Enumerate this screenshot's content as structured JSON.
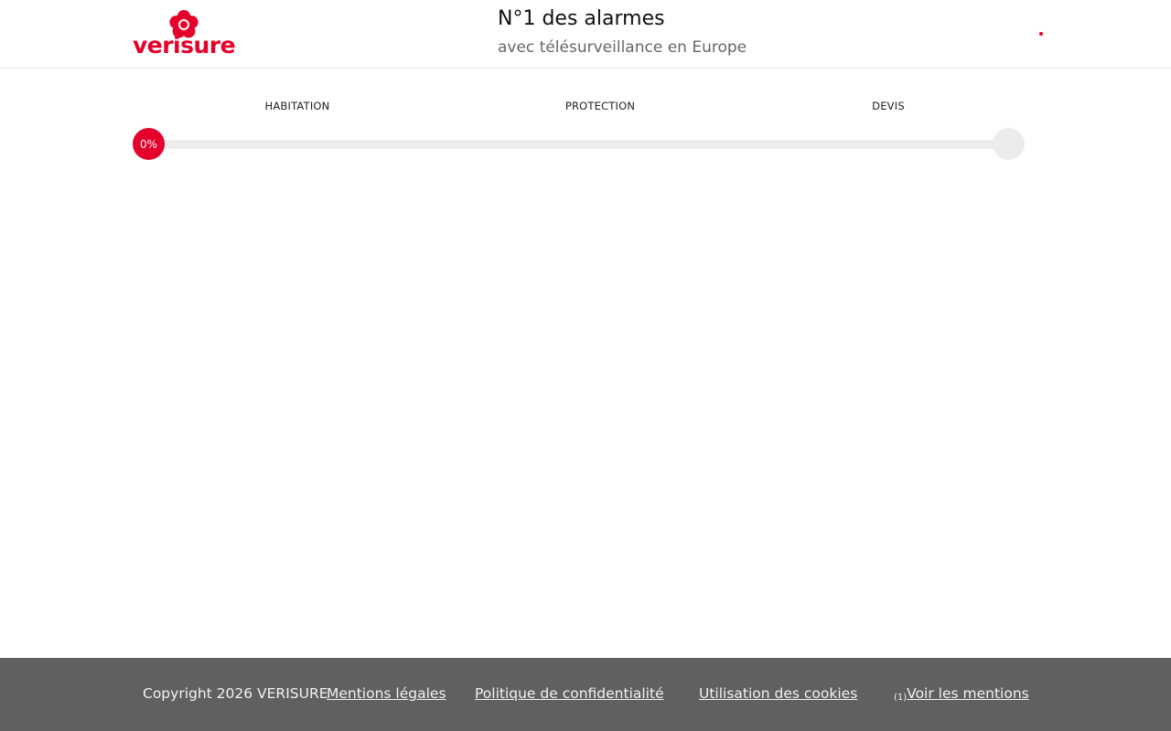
{
  "header": {
    "brand": "verisure",
    "tagline_title": "N°1 des alarmes",
    "tagline_subtitle": "avec télésurveillance en Europe"
  },
  "steps": [
    {
      "label": "HABITATION"
    },
    {
      "label": "PROTECTION"
    },
    {
      "label": "DEVIS"
    }
  ],
  "progress": {
    "percent": 0,
    "label": "0%"
  },
  "footer": {
    "copyright": "Copyright 2026 VERISURE",
    "links": [
      {
        "label": "Mentions légales"
      },
      {
        "label": "Politique de confidentialité"
      },
      {
        "label": "Utilisation des cookies"
      }
    ],
    "mentions_marker": "(1)",
    "mentions_label": "Voir les mentions"
  },
  "colors": {
    "brand_red": "#e4002b",
    "track_grey": "#ececec",
    "footer_bg": "#5f6062"
  }
}
